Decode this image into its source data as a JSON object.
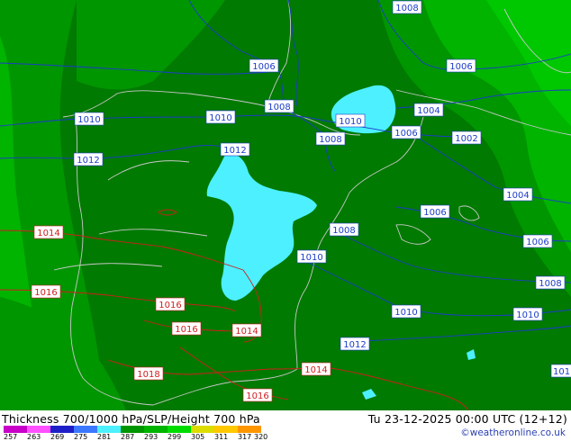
{
  "map": {
    "title": "Thickness 700/1000 hPa/SLP/Height 700 hPa",
    "valid_time": "Tu 23-12-2025 00:00 UTC (12+12)",
    "credit": "©weatheronline.co.uk",
    "colors": {
      "dark_green": "#007a00",
      "mid_green": "#009600",
      "light_green": "#00b400",
      "bright_green": "#00c800",
      "cyan": "#4cf0ff",
      "isobar_blue": "#1c3cc8",
      "isobar_red": "#d01e1e",
      "coast": "#c8c8c8"
    },
    "isobars_blue": [
      {
        "label": "1008"
      },
      {
        "label": "1006"
      },
      {
        "label": "1006"
      },
      {
        "label": "1010"
      },
      {
        "label": "1010"
      },
      {
        "label": "1008"
      },
      {
        "label": "1010"
      },
      {
        "label": "1004"
      },
      {
        "label": "1008"
      },
      {
        "label": "1006"
      },
      {
        "label": "1002"
      },
      {
        "label": "1012"
      },
      {
        "label": "1012"
      },
      {
        "label": "1004"
      },
      {
        "label": "1006"
      },
      {
        "label": "1008"
      },
      {
        "label": "1006"
      },
      {
        "label": "1010"
      },
      {
        "label": "1008"
      },
      {
        "label": "1010"
      },
      {
        "label": "1010"
      },
      {
        "label": "1012"
      },
      {
        "label": "101"
      }
    ],
    "isobars_red": [
      {
        "label": "1014"
      },
      {
        "label": "1016"
      },
      {
        "label": "1016"
      },
      {
        "label": "1016"
      },
      {
        "label": "1014"
      },
      {
        "label": "1018"
      },
      {
        "label": "1014"
      },
      {
        "label": "1016"
      }
    ],
    "legend": {
      "ticks": [
        "257",
        "263",
        "269",
        "275",
        "281",
        "287",
        "293",
        "299",
        "305",
        "311",
        "317",
        "320"
      ],
      "colors": [
        "#c800c8",
        "#ff50ff",
        "#1e1ec8",
        "#3c78ff",
        "#4cf0ff",
        "#009600",
        "#00b400",
        "#00dc00",
        "#dcdc00",
        "#ffc800",
        "#ff9600"
      ]
    }
  }
}
